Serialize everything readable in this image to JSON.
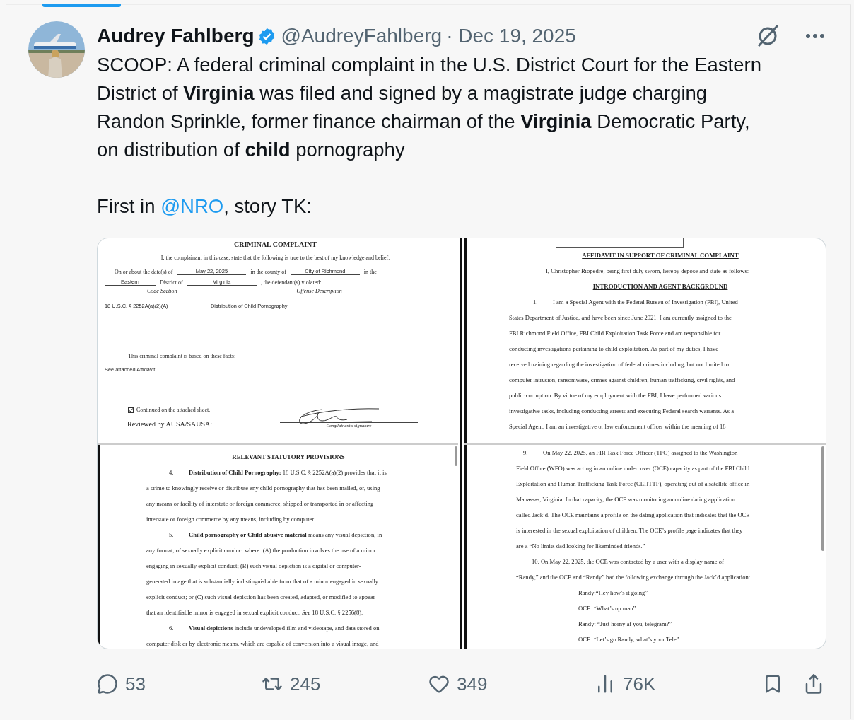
{
  "author": {
    "name": "Audrey Fahlberg",
    "verified": true,
    "handle": "@AudreyFahlberg",
    "date": "· Dec 19, 2025"
  },
  "body": {
    "paragraphs": [
      {
        "text": "SCOOP: A federal criminal complaint in the U.S. District Court for the Eastern District of **Virginia** was filed and signed by a magistrate judge charging Randon Sprinkle, former finance chairman of the **Virginia** Democratic Party, on distribution of **child** pornography"
      },
      {
        "before": "First in ",
        "link": "@NRO",
        "after": ", story TK:"
      }
    ]
  },
  "media": {
    "pages": [
      {
        "kind": "complaint",
        "lines": [
          {
            "kind": "title",
            "text": "CRIMINAL COMPLAINT"
          },
          {
            "kind": "center",
            "text": "I, the complainant in this case, state that the following is true to the best of my knowledge and belief."
          },
          {
            "kind": "form",
            "parts": [
              {
                "kind": "label",
                "text": "On or about the date(s) of"
              },
              {
                "kind": "blank",
                "text": "May 22, 2025"
              },
              {
                "kind": "label",
                "text": "in the county of"
              },
              {
                "kind": "blank",
                "text": "City of Richmond"
              },
              {
                "kind": "label",
                "text": "in the"
              }
            ]
          },
          {
            "kind": "form",
            "parts": [
              {
                "kind": "blank",
                "text": "Eastern"
              },
              {
                "kind": "label",
                "text": "District of"
              },
              {
                "kind": "blank",
                "text": "Virginia"
              },
              {
                "kind": "label",
                "text": ", the defendant(s) violated:"
              }
            ]
          },
          {
            "kind": "colhead",
            "cells": [
              "Code Section",
              "Offense Description"
            ]
          },
          {
            "kind": "row",
            "cells": [
              "18 U.S.C. § 2252A(a)(2)(A)",
              "Distribution of Child Pornography"
            ]
          },
          {
            "kind": "indent",
            "text": "This criminal complaint is based on these facts:"
          },
          {
            "kind": "sans",
            "text": "See attached Affidavit."
          },
          {
            "kind": "check",
            "checked": true,
            "text": "Continued on the attached sheet."
          },
          {
            "kind": "signature",
            "left": "Reviewed by AUSA/SAUSA:",
            "caption": "Complainant's signature"
          }
        ]
      },
      {
        "kind": "affidavit",
        "lines": [
          {
            "kind": "cutbox"
          },
          {
            "kind": "heading",
            "text": "AFFIDAVIT IN SUPPORT OF CRIMINAL COMPLAINT"
          },
          {
            "kind": "indent",
            "text": "I, Christopher Riopedre, being first duly sworn, hereby depose and state as follows:"
          },
          {
            "kind": "heading",
            "text": "INTRODUCTION AND AGENT BACKGROUND"
          },
          {
            "kind": "numbered",
            "number": "1.",
            "text": "I am a Special Agent with the Federal Bureau of Investigation (FBI), United"
          },
          {
            "kind": "line",
            "text": "States Department of Justice, and have been since June 2021.  I am currently assigned to the"
          },
          {
            "kind": "line",
            "text": "FBI Richmond Field Office, FBI Child Exploitation Task Force and am responsible for"
          },
          {
            "kind": "line",
            "text": "conducting investigations pertaining to child exploitation.  As part of my duties, I have"
          },
          {
            "kind": "line",
            "text": "received training regarding the investigation of federal crimes including, but not limited to"
          },
          {
            "kind": "line",
            "text": "computer intrusion, ransomware, crimes against children, human trafficking, civil rights, and"
          },
          {
            "kind": "line",
            "text": "public corruption.  By virtue of my employment with the FBI, I have performed various"
          },
          {
            "kind": "line",
            "text": "investigative tasks, including conducting arrests and executing Federal search warrants.  As a"
          },
          {
            "kind": "line",
            "text": "Special Agent, I am an investigative or law enforcement officer within the meaning of 18"
          }
        ]
      },
      {
        "kind": "provisions",
        "lines": [
          {
            "kind": "heading",
            "text": "RELEVANT STATUTORY PROVISIONS"
          },
          {
            "kind": "numbered",
            "number": "4.",
            "text": "**Distribution of Child Pornography:** 18 U.S.C. § 2252A(a)(2) provides that it is"
          },
          {
            "kind": "line",
            "text": "a crime to knowingly receive or distribute any child pornography that has been mailed, or, using"
          },
          {
            "kind": "line",
            "text": "any means or facility of interstate or foreign commerce, shipped or transported in or affecting"
          },
          {
            "kind": "line",
            "text": "interstate or foreign commerce by any means, including by computer."
          },
          {
            "kind": "numbered",
            "number": "5.",
            "text": "**Child pornography or Child abusive material** means any visual depiction, in"
          },
          {
            "kind": "line",
            "text": "any format, of sexually explicit conduct where: (A) the production involves the use of a minor"
          },
          {
            "kind": "line",
            "text": "engaging in sexually explicit conduct; (B) such visual depiction is a digital or computer-"
          },
          {
            "kind": "line",
            "text": "generated image that is substantially indistinguishable from that of a minor engaged in sexually"
          },
          {
            "kind": "line",
            "text": "explicit conduct; or (C) such visual depiction has been created, adapted, or modified to appear"
          },
          {
            "kind": "line",
            "text": "that an identifiable minor is engaged in sexual explicit conduct.  *See* 18 U.S.C. § 2256(8)."
          },
          {
            "kind": "numbered",
            "number": "6.",
            "text": "**Visual depictions** include undeveloped film and videotape, and data stored on"
          },
          {
            "kind": "line",
            "text": "computer disk or by electronic means, which are capable of conversion into a visual image, and"
          }
        ]
      },
      {
        "kind": "exchange",
        "lines": [
          {
            "kind": "numbered",
            "number": "9.",
            "text": "On May 22, 2025, an FBI Task Force Officer (TFO) assigned to the Washington"
          },
          {
            "kind": "line",
            "text": "Field Office (WFO) was acting in an online undercover (OCE) capacity as part of the FBI Child"
          },
          {
            "kind": "line",
            "text": "Exploitation and Human Trafficking Task Force (CEHTTF), operating out of a satellite office in"
          },
          {
            "kind": "line",
            "text": "Manassas, Virginia.  In that capacity, the OCE was monitoring an online dating application"
          },
          {
            "kind": "line",
            "text": "called Jack’d.  The OCE maintains a profile on the dating application that indicates that the OCE"
          },
          {
            "kind": "line",
            "text": "is interested in the sexual exploitation of children.  The OCE’s profile page indicates that they"
          },
          {
            "kind": "line",
            "text": "are a “No limits dad looking for likeminded friends.”"
          },
          {
            "kind": "indent",
            "text": "10. On May 22, 2025, the OCE was contacted by a user with a display name of"
          },
          {
            "kind": "line",
            "text": "“Randy,” and the OCE and “Randy” had the following exchange through the Jack’d application:"
          },
          {
            "kind": "dialog",
            "text": "Randy:“Hey how’s it going”"
          },
          {
            "kind": "dialog",
            "text": "OCE: “What’s up man”"
          },
          {
            "kind": "dialog",
            "text": "Randy: “Just horny af you, telegram?”"
          },
          {
            "kind": "dialog",
            "text": "OCE: “Let’s go Randy, what’s your Tele”"
          }
        ]
      }
    ]
  },
  "actions": [
    {
      "kind": "reply",
      "count": "53"
    },
    {
      "kind": "repost",
      "count": "245"
    },
    {
      "kind": "like",
      "count": "349"
    },
    {
      "kind": "views",
      "count": "76K"
    },
    {
      "kind": "bookmark"
    },
    {
      "kind": "share"
    }
  ]
}
